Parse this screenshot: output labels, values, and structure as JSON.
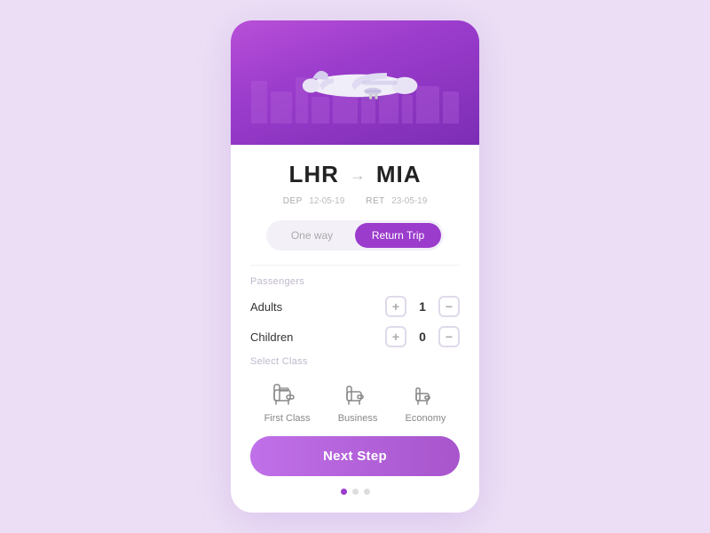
{
  "header": {
    "bg_color": "#9b3ccc"
  },
  "route": {
    "from": "LHR",
    "to": "MIA",
    "arrow": "→",
    "dep_label": "DEP",
    "dep_date": "12-05-19",
    "ret_label": "RET",
    "ret_date": "23-05-19"
  },
  "trip_type": {
    "one_way_label": "One way",
    "return_trip_label": "Return Trip",
    "active": "return"
  },
  "passengers": {
    "section_label": "Passengers",
    "adults_label": "Adults",
    "adults_count": "1",
    "children_label": "Children",
    "children_count": "0"
  },
  "class_selection": {
    "section_label": "Select Class",
    "options": [
      {
        "id": "first",
        "label": "First Class"
      },
      {
        "id": "business",
        "label": "Business"
      },
      {
        "id": "economy",
        "label": "Economy"
      }
    ]
  },
  "next_button_label": "Next Step",
  "pagination": {
    "total": 3,
    "active_index": 0
  }
}
